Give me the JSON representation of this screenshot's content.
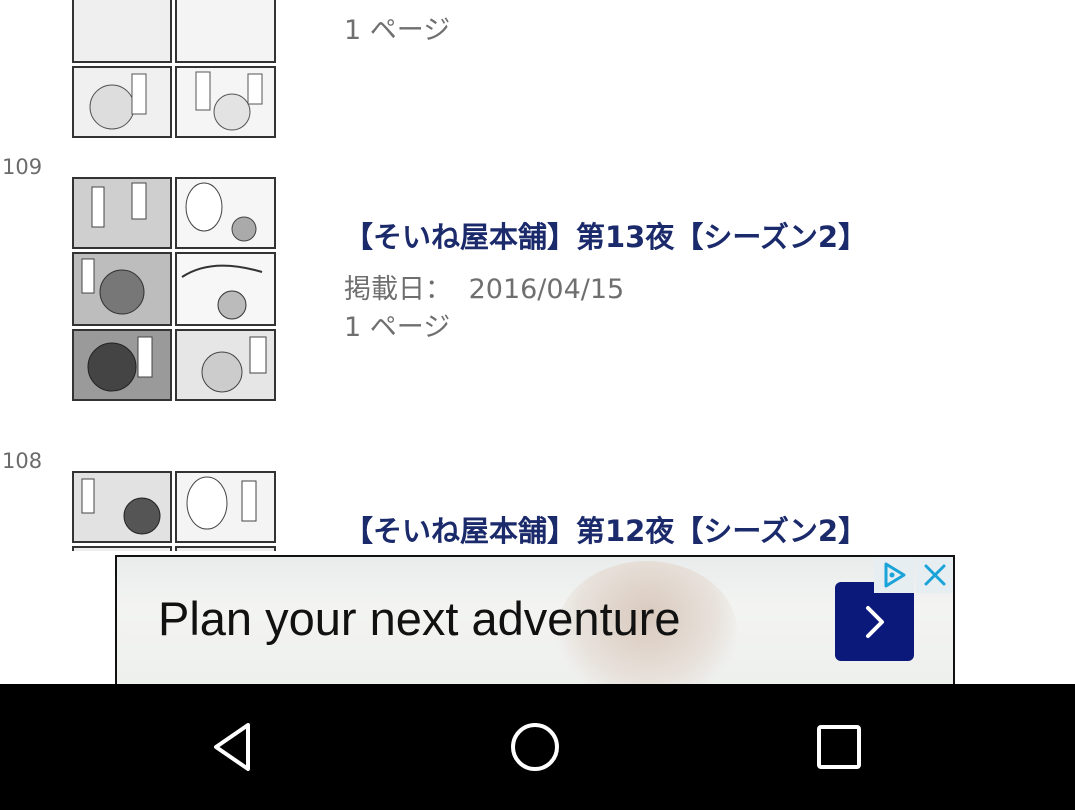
{
  "episodes": [
    {
      "number": "",
      "title": "",
      "date_label": "",
      "date": "",
      "pages": "1 ページ"
    },
    {
      "number": "109",
      "title": "【そいね屋本舗】第13夜【シーズン2】",
      "date_label": "掲載日：",
      "date": "2016/04/15",
      "pages": "1 ページ"
    },
    {
      "number": "108",
      "title": "【そいね屋本舗】第12夜【シーズン2】",
      "date_label": "",
      "date": "",
      "pages": ""
    }
  ],
  "ad": {
    "text": "Plan your next adventure",
    "go_icon": "chevron-right-icon",
    "choices_icon": "adchoices-icon",
    "close_icon": "close-icon",
    "accent": "#0b1a7a"
  },
  "navbar": {
    "back_icon": "back-triangle-icon",
    "home_icon": "home-circle-icon",
    "recents_icon": "recents-square-icon"
  }
}
